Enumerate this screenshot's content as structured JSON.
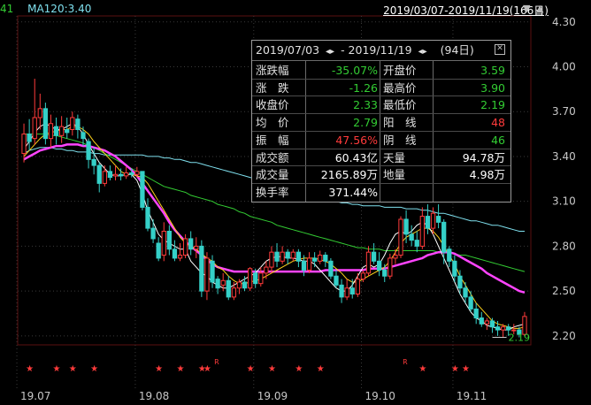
{
  "header": {
    "left_code": "41",
    "ma_legend": "MA120:3.40",
    "range_label": "2019/03/07-2019/11/19(166日)",
    "down_arrow": "▼",
    "up_arrow": "▲"
  },
  "colors": {
    "up": "#ff3b3b",
    "down": "#35d0c8",
    "ma5": "#ffffff",
    "ma10": "#ffd21a",
    "ma20": "#ff44ff",
    "ma60": "#33cc33",
    "ma120": "#7fe0ee",
    "grid": "#3a3a3a",
    "panel_border": "#9a9a9a",
    "value_green": "#33cc33",
    "value_red": "#ff3b3b",
    "value_white": "#ffffff"
  },
  "info_panel": {
    "start_date": "2019/07/03",
    "end_date": "2019/11/19",
    "separator": "- ",
    "nav_arrows": "◂▸",
    "days": "(94日)",
    "rows": [
      {
        "l1": "涨跌幅",
        "v1": "-35.07%",
        "c1": "green",
        "l2": "开盘价",
        "v2": "3.59",
        "c2": "green"
      },
      {
        "l1": "涨　跌",
        "v1": "-1.26",
        "c1": "green",
        "l2": "最高价",
        "v2": "3.90",
        "c2": "green"
      },
      {
        "l1": "收盘价",
        "v1": "2.33",
        "c1": "green",
        "l2": "最低价",
        "v2": "2.19",
        "c2": "green"
      },
      {
        "l1": "均　价",
        "v1": "2.79",
        "c1": "green",
        "l2": "阳　线",
        "v2": "48",
        "c2": "red"
      },
      {
        "l1": "振　幅",
        "v1": "47.56%",
        "c1": "red",
        "l2": "阴　线",
        "v2": "46",
        "c2": "green"
      },
      {
        "l1": "成交额",
        "v1": "60.43亿",
        "c1": "white",
        "l2": "天量",
        "v2": "94.78万",
        "c2": "white"
      },
      {
        "l1": "成交量",
        "v1": "2165.89万",
        "c1": "white",
        "l2": "地量",
        "v2": "4.98万",
        "c2": "white"
      },
      {
        "l1": "换手率",
        "v1": "371.44%",
        "c1": "white",
        "l2": "",
        "v2": "",
        "c2": "white"
      }
    ]
  },
  "chart_data": {
    "type": "candlestick",
    "y_ticks": [
      "4.30",
      "4.00",
      "3.70",
      "3.40",
      "3.10",
      "2.80",
      "2.50",
      "2.20"
    ],
    "ylim": [
      2.14,
      4.34
    ],
    "x_ticks": [
      {
        "label": "19.07",
        "index": 0
      },
      {
        "label": "19.08",
        "index": 22
      },
      {
        "label": "19.09",
        "index": 44
      },
      {
        "label": "19.10",
        "index": 64
      },
      {
        "label": "19.11",
        "index": 81
      }
    ],
    "low_marker": "2.19",
    "candles": [
      [
        3.42,
        3.55,
        3.62,
        3.36
      ],
      [
        3.55,
        3.5,
        3.65,
        3.44
      ],
      [
        3.52,
        3.66,
        3.92,
        3.48
      ],
      [
        3.66,
        3.72,
        3.82,
        3.58
      ],
      [
        3.72,
        3.52,
        3.76,
        3.48
      ],
      [
        3.52,
        3.62,
        3.68,
        3.46
      ],
      [
        3.6,
        3.54,
        3.66,
        3.48
      ],
      [
        3.54,
        3.6,
        3.67,
        3.49
      ],
      [
        3.58,
        3.56,
        3.66,
        3.52
      ],
      [
        3.58,
        3.66,
        3.7,
        3.54
      ],
      [
        3.65,
        3.58,
        3.68,
        3.52
      ],
      [
        3.56,
        3.52,
        3.6,
        3.47
      ],
      [
        3.5,
        3.38,
        3.52,
        3.32
      ],
      [
        3.38,
        3.34,
        3.46,
        3.28
      ],
      [
        3.34,
        3.22,
        3.36,
        3.16
      ],
      [
        3.22,
        3.3,
        3.34,
        3.2
      ],
      [
        3.3,
        3.26,
        3.34,
        3.24
      ],
      [
        3.27,
        3.28,
        3.34,
        3.24
      ],
      [
        3.28,
        3.27,
        3.32,
        3.24
      ],
      [
        3.27,
        3.29,
        3.33,
        3.25
      ],
      [
        3.29,
        3.28,
        3.32,
        3.26
      ],
      [
        3.28,
        3.3,
        3.33,
        3.26
      ],
      [
        3.3,
        3.06,
        3.3,
        3.04
      ],
      [
        3.06,
        2.92,
        3.12,
        2.9
      ],
      [
        2.92,
        2.85,
        2.98,
        2.82
      ],
      [
        2.82,
        2.72,
        2.86,
        2.7
      ],
      [
        2.74,
        2.9,
        2.96,
        2.7
      ],
      [
        2.9,
        2.78,
        2.94,
        2.74
      ],
      [
        2.78,
        2.72,
        2.84,
        2.7
      ],
      [
        2.72,
        2.74,
        2.82,
        2.7
      ],
      [
        2.74,
        2.85,
        2.88,
        2.72
      ],
      [
        2.85,
        2.78,
        2.9,
        2.74
      ],
      [
        2.78,
        2.8,
        2.86,
        2.72
      ],
      [
        2.8,
        2.5,
        2.84,
        2.46
      ],
      [
        2.5,
        2.72,
        2.76,
        2.44
      ],
      [
        2.7,
        2.56,
        2.74,
        2.52
      ],
      [
        2.58,
        2.52,
        2.6,
        2.48
      ],
      [
        2.54,
        2.57,
        2.62,
        2.5
      ],
      [
        2.57,
        2.46,
        2.6,
        2.44
      ],
      [
        2.46,
        2.52,
        2.56,
        2.44
      ],
      [
        2.52,
        2.56,
        2.58,
        2.48
      ],
      [
        2.56,
        2.52,
        2.6,
        2.5
      ],
      [
        2.52,
        2.65,
        2.66,
        2.5
      ],
      [
        2.62,
        2.55,
        2.65,
        2.52
      ],
      [
        2.55,
        2.62,
        2.66,
        2.53
      ],
      [
        2.62,
        2.66,
        2.7,
        2.58
      ],
      [
        2.66,
        2.76,
        2.8,
        2.62
      ],
      [
        2.76,
        2.7,
        2.82,
        2.66
      ],
      [
        2.7,
        2.76,
        2.8,
        2.68
      ],
      [
        2.76,
        2.72,
        2.78,
        2.68
      ],
      [
        2.72,
        2.76,
        2.78,
        2.7
      ],
      [
        2.76,
        2.7,
        2.78,
        2.66
      ],
      [
        2.7,
        2.64,
        2.74,
        2.6
      ],
      [
        2.64,
        2.72,
        2.76,
        2.62
      ],
      [
        2.72,
        2.7,
        2.76,
        2.66
      ],
      [
        2.7,
        2.74,
        2.77,
        2.68
      ],
      [
        2.74,
        2.7,
        2.76,
        2.66
      ],
      [
        2.7,
        2.6,
        2.72,
        2.58
      ],
      [
        2.6,
        2.54,
        2.64,
        2.52
      ],
      [
        2.54,
        2.46,
        2.58,
        2.42
      ],
      [
        2.46,
        2.52,
        2.58,
        2.44
      ],
      [
        2.52,
        2.48,
        2.58,
        2.45
      ],
      [
        2.48,
        2.58,
        2.62,
        2.46
      ],
      [
        2.58,
        2.62,
        2.64,
        2.56
      ],
      [
        2.62,
        2.76,
        2.8,
        2.6
      ],
      [
        2.76,
        2.7,
        2.82,
        2.68
      ],
      [
        2.7,
        2.64,
        2.76,
        2.6
      ],
      [
        2.64,
        2.6,
        2.68,
        2.56
      ],
      [
        2.6,
        2.72,
        2.75,
        2.58
      ],
      [
        2.72,
        2.74,
        2.78,
        2.68
      ],
      [
        2.74,
        2.98,
        3.0,
        2.72
      ],
      [
        2.98,
        2.88,
        3.04,
        2.82
      ],
      [
        2.88,
        2.84,
        2.94,
        2.8
      ],
      [
        2.84,
        2.8,
        2.9,
        2.76
      ],
      [
        2.8,
        3.0,
        3.06,
        2.78
      ],
      [
        3.0,
        2.92,
        3.08,
        2.88
      ],
      [
        2.92,
        3.02,
        3.06,
        2.88
      ],
      [
        3.0,
        2.96,
        3.08,
        2.92
      ],
      [
        2.96,
        2.76,
        2.98,
        2.68
      ],
      [
        2.78,
        2.7,
        2.8,
        2.66
      ],
      [
        2.7,
        2.6,
        2.74,
        2.56
      ],
      [
        2.6,
        2.52,
        2.64,
        2.48
      ],
      [
        2.52,
        2.46,
        2.56,
        2.42
      ],
      [
        2.46,
        2.38,
        2.5,
        2.36
      ],
      [
        2.38,
        2.32,
        2.42,
        2.28
      ],
      [
        2.32,
        2.28,
        2.36,
        2.26
      ],
      [
        2.28,
        2.3,
        2.32,
        2.24
      ],
      [
        2.3,
        2.26,
        2.32,
        2.22
      ],
      [
        2.26,
        2.24,
        2.3,
        2.2
      ],
      [
        2.24,
        2.26,
        2.28,
        2.19
      ],
      [
        2.26,
        2.24,
        2.28,
        2.2
      ],
      [
        2.24,
        2.24,
        2.28,
        2.21
      ],
      [
        2.24,
        2.21,
        2.26,
        2.19
      ],
      [
        2.21,
        2.33,
        2.36,
        2.2
      ]
    ],
    "ma120": [
      3.42,
      3.44,
      3.45,
      3.46,
      3.46,
      3.46,
      3.45,
      3.45,
      3.44,
      3.44,
      3.43,
      3.43,
      3.43,
      3.42,
      3.42,
      3.41,
      3.41,
      3.41,
      3.41,
      3.41,
      3.41,
      3.41,
      3.41,
      3.4,
      3.4,
      3.4,
      3.39,
      3.39,
      3.38,
      3.38,
      3.37,
      3.36,
      3.36,
      3.35,
      3.34,
      3.33,
      3.32,
      3.31,
      3.3,
      3.29,
      3.28,
      3.27,
      3.26,
      3.25,
      3.24,
      3.23,
      3.22,
      3.21,
      3.2,
      3.19,
      3.18,
      3.17,
      3.16,
      3.15,
      3.14,
      3.13,
      3.12,
      3.11,
      3.1,
      3.09,
      3.09,
      3.08,
      3.08,
      3.07,
      3.07,
      3.07,
      3.07,
      3.06,
      3.06,
      3.06,
      3.06,
      3.05,
      3.05,
      3.05,
      3.04,
      3.04,
      3.03,
      3.02,
      3.02,
      3.01,
      3.0,
      2.99,
      2.98,
      2.97,
      2.97,
      2.96,
      2.95,
      2.94,
      2.94,
      2.93,
      2.92,
      2.91,
      2.9,
      2.9
    ],
    "ma60": [
      3.55,
      3.55,
      3.55,
      3.55,
      3.55,
      3.54,
      3.54,
      3.53,
      3.52,
      3.51,
      3.5,
      3.49,
      3.47,
      3.46,
      3.44,
      3.42,
      3.4,
      3.38,
      3.36,
      3.34,
      3.32,
      3.3,
      3.28,
      3.26,
      3.24,
      3.22,
      3.2,
      3.19,
      3.18,
      3.17,
      3.16,
      3.14,
      3.13,
      3.12,
      3.11,
      3.1,
      3.08,
      3.07,
      3.06,
      3.05,
      3.03,
      3.02,
      3.0,
      2.99,
      2.98,
      2.97,
      2.96,
      2.94,
      2.93,
      2.92,
      2.91,
      2.9,
      2.89,
      2.88,
      2.87,
      2.86,
      2.85,
      2.84,
      2.83,
      2.82,
      2.81,
      2.8,
      2.79,
      2.79,
      2.78,
      2.78,
      2.78,
      2.77,
      2.77,
      2.77,
      2.77,
      2.77,
      2.77,
      2.77,
      2.77,
      2.77,
      2.77,
      2.76,
      2.76,
      2.76,
      2.75,
      2.74,
      2.74,
      2.73,
      2.72,
      2.71,
      2.7,
      2.69,
      2.68,
      2.67,
      2.66,
      2.65,
      2.64,
      2.63
    ],
    "ma20": [
      3.38,
      3.4,
      3.42,
      3.44,
      3.45,
      3.46,
      3.47,
      3.47,
      3.48,
      3.48,
      3.48,
      3.47,
      3.47,
      3.46,
      3.45,
      3.44,
      3.42,
      3.4,
      3.37,
      3.34,
      3.31,
      3.27,
      3.22,
      3.17,
      3.12,
      3.07,
      3.02,
      2.96,
      2.91,
      2.87,
      2.83,
      2.8,
      2.77,
      2.74,
      2.71,
      2.68,
      2.66,
      2.65,
      2.64,
      2.63,
      2.63,
      2.63,
      2.63,
      2.63,
      2.63,
      2.63,
      2.63,
      2.63,
      2.63,
      2.63,
      2.63,
      2.63,
      2.63,
      2.63,
      2.63,
      2.63,
      2.64,
      2.64,
      2.64,
      2.64,
      2.64,
      2.64,
      2.64,
      2.64,
      2.65,
      2.65,
      2.65,
      2.65,
      2.66,
      2.67,
      2.68,
      2.69,
      2.7,
      2.71,
      2.72,
      2.74,
      2.75,
      2.76,
      2.76,
      2.76,
      2.75,
      2.73,
      2.71,
      2.69,
      2.67,
      2.65,
      2.62,
      2.6,
      2.58,
      2.56,
      2.54,
      2.52,
      2.5,
      2.49
    ],
    "ma10": [
      3.4,
      3.44,
      3.48,
      3.52,
      3.55,
      3.56,
      3.57,
      3.58,
      3.58,
      3.6,
      3.6,
      3.58,
      3.55,
      3.5,
      3.46,
      3.42,
      3.38,
      3.34,
      3.3,
      3.28,
      3.28,
      3.27,
      3.26,
      3.22,
      3.16,
      3.1,
      3.04,
      2.98,
      2.92,
      2.86,
      2.82,
      2.8,
      2.78,
      2.75,
      2.72,
      2.7,
      2.66,
      2.64,
      2.6,
      2.57,
      2.55,
      2.55,
      2.56,
      2.57,
      2.58,
      2.6,
      2.62,
      2.64,
      2.66,
      2.68,
      2.7,
      2.71,
      2.72,
      2.72,
      2.72,
      2.71,
      2.7,
      2.68,
      2.65,
      2.62,
      2.58,
      2.56,
      2.56,
      2.58,
      2.6,
      2.62,
      2.64,
      2.66,
      2.7,
      2.76,
      2.82,
      2.86,
      2.88,
      2.9,
      2.92,
      2.92,
      2.9,
      2.86,
      2.8,
      2.74,
      2.68,
      2.6,
      2.54,
      2.48,
      2.42,
      2.38,
      2.34,
      2.3,
      2.28,
      2.27,
      2.26,
      2.25,
      2.25,
      2.26
    ],
    "ma5": [
      3.45,
      3.5,
      3.56,
      3.6,
      3.62,
      3.6,
      3.58,
      3.58,
      3.6,
      3.62,
      3.6,
      3.55,
      3.48,
      3.42,
      3.36,
      3.32,
      3.28,
      3.27,
      3.27,
      3.28,
      3.28,
      3.24,
      3.15,
      3.04,
      2.96,
      2.88,
      2.84,
      2.82,
      2.8,
      2.78,
      2.78,
      2.7,
      2.66,
      2.62,
      2.6,
      2.56,
      2.54,
      2.52,
      2.52,
      2.54,
      2.56,
      2.58,
      2.6,
      2.62,
      2.66,
      2.7,
      2.72,
      2.73,
      2.73,
      2.72,
      2.72,
      2.71,
      2.7,
      2.7,
      2.68,
      2.64,
      2.6,
      2.56,
      2.52,
      2.5,
      2.5,
      2.54,
      2.6,
      2.66,
      2.68,
      2.66,
      2.68,
      2.74,
      2.82,
      2.88,
      2.9,
      2.88,
      2.9,
      2.94,
      2.96,
      2.94,
      2.88,
      2.8,
      2.72,
      2.64,
      2.56,
      2.48,
      2.42,
      2.36,
      2.32,
      2.3,
      2.27,
      2.26,
      2.25,
      2.24,
      2.24,
      2.26,
      2.27,
      2.28
    ],
    "signals_bottom": [
      {
        "index": 1,
        "text": "★"
      },
      {
        "index": 6,
        "text": "★"
      },
      {
        "index": 9,
        "text": "★"
      },
      {
        "index": 13,
        "text": "★"
      },
      {
        "index": 25,
        "text": "★"
      },
      {
        "index": 29,
        "text": "★"
      },
      {
        "index": 33,
        "text": "★"
      },
      {
        "index": 34,
        "text": "★"
      },
      {
        "index": 36,
        "text": "R"
      },
      {
        "index": 42,
        "text": "★"
      },
      {
        "index": 46,
        "text": "★"
      },
      {
        "index": 51,
        "text": "★"
      },
      {
        "index": 55,
        "text": "★"
      },
      {
        "index": 71,
        "text": "R"
      },
      {
        "index": 74,
        "text": "★"
      },
      {
        "index": 80,
        "text": "★"
      },
      {
        "index": 82,
        "text": "★"
      }
    ]
  }
}
